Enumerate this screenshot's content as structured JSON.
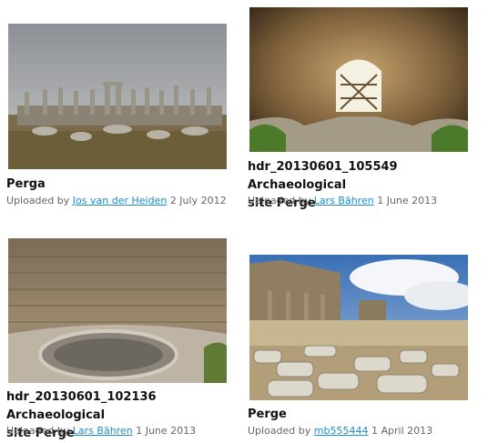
{
  "gallery": {
    "items": [
      {
        "title": "Perga",
        "uploaded_prefix": "Uploaded by",
        "author": "Jos van der Heiden",
        "date": "2 July 2012"
      },
      {
        "title_line1": "hdr_20130601_105549 Archaeological",
        "title_line2": "site Perge",
        "uploaded_prefix": "Uploaded by",
        "author": "Lars Bähren",
        "date": "1 June 2013"
      },
      {
        "title_line1": "hdr_20130601_102136 Archaeological",
        "title_line2": "site Perge",
        "uploaded_prefix": "Uploaded by",
        "author": "Lars Bähren",
        "date": "1 June 2013"
      },
      {
        "title": "Perge",
        "uploaded_prefix": "Uploaded by",
        "author": "mb555444",
        "date": "1 April 2013"
      }
    ]
  },
  "colors": {
    "link": "#1a8ec9",
    "meta_text": "#666666",
    "title_text": "#111111"
  }
}
